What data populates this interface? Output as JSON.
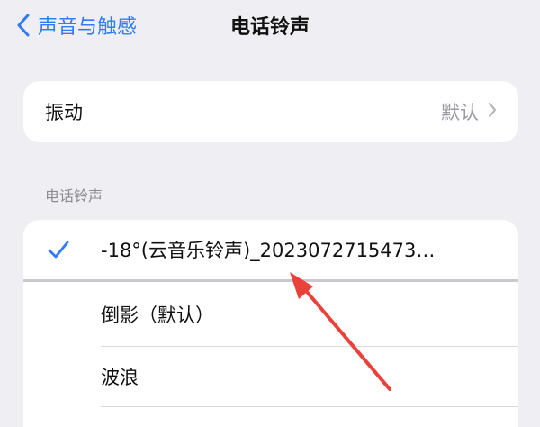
{
  "nav": {
    "back_label": "声音与触感",
    "title": "电话铃声"
  },
  "vibration": {
    "label": "振动",
    "value": "默认"
  },
  "ringtones": {
    "section_header": "电话铃声",
    "items": [
      {
        "label": "-18°(云音乐铃声)_2023072715473…",
        "selected": true
      },
      {
        "label": "倒影（默认）",
        "selected": false
      },
      {
        "label": "波浪",
        "selected": false
      }
    ]
  },
  "colors": {
    "accent": "#2f7cf6",
    "arrow": "#e8423a"
  }
}
